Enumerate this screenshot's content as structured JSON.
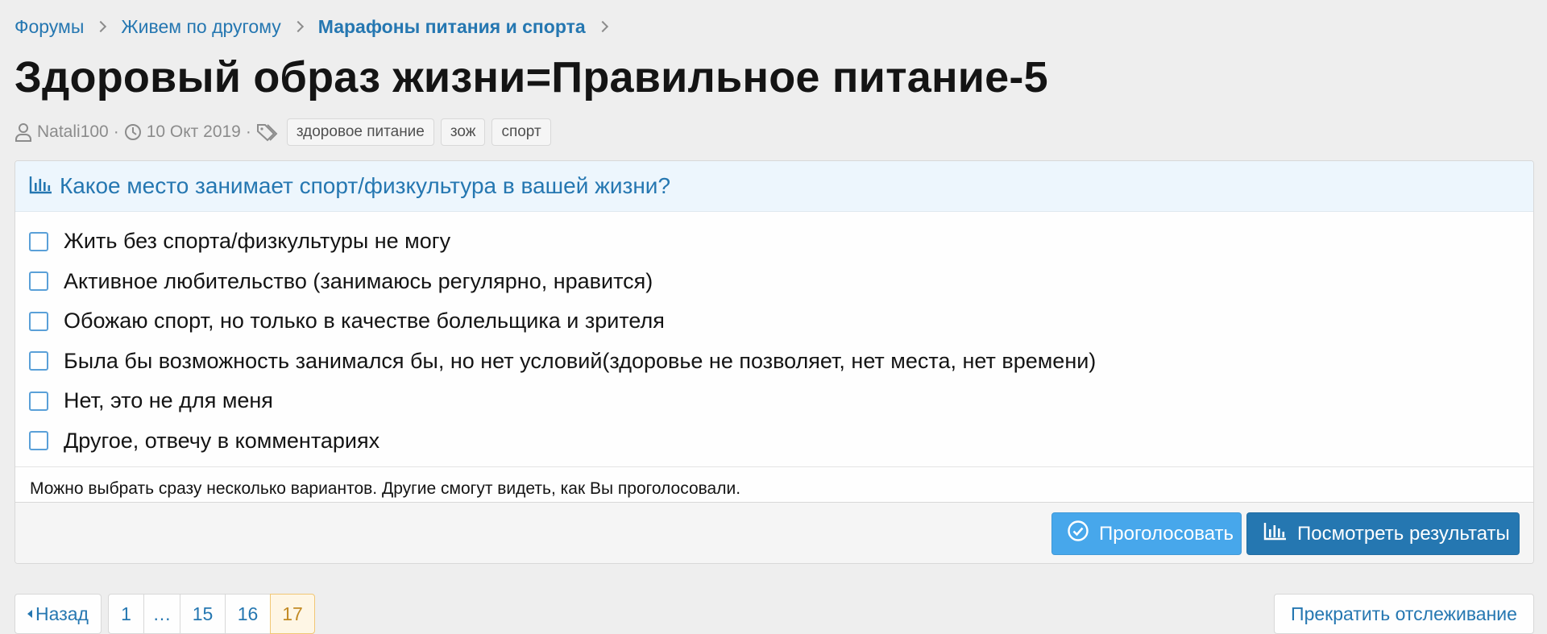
{
  "breadcrumb": {
    "items": [
      "Форумы",
      "Живем по другому",
      "Марафоны питания и спорта"
    ]
  },
  "thread": {
    "title": "Здоровый образ жизни=Правильное питание-5",
    "author": "Natali100",
    "date": "10 Окт 2019",
    "tags": [
      "здоровое питание",
      "зож",
      "спорт"
    ]
  },
  "poll": {
    "question": "Какое место занимает спорт/физкультура в вашей жизни?",
    "options": [
      "Жить без спорта/физкультуры не могу",
      "Активное любительство (занимаюсь регулярно, нравится)",
      "Обожаю спорт, но только в качестве болельщика и зрителя",
      "Была бы возможность занимался бы, но нет условий(здоровье не позволяет, нет места, нет времени)",
      "Нет, это не для меня",
      "Другое, отвечу в комментариях"
    ],
    "hint": "Можно выбрать сразу несколько вариантов. Другие смогут видеть, как Вы проголосовали.",
    "vote_label": "Проголосовать",
    "results_label": "Посмотреть результаты"
  },
  "pagination": {
    "prev_label": "Назад",
    "pages": [
      "1",
      "…",
      "15",
      "16",
      "17"
    ],
    "current": "17"
  },
  "unwatch_label": "Прекратить отслеживание",
  "colors": {
    "link": "#2577b1",
    "vote_button": "#47a7eb",
    "results_button": "#2577b1",
    "current_page": "#fef6e5"
  },
  "icons": {
    "author": "user-icon",
    "date": "clock-icon",
    "tags": "tags-icon",
    "poll": "bar-chart-icon",
    "vote": "check-circle-icon"
  }
}
